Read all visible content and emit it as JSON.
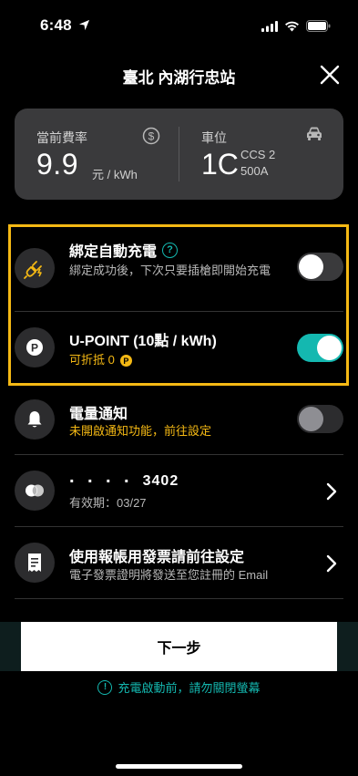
{
  "status": {
    "time": "6:48"
  },
  "header": {
    "title": "臺北 內湖行忠站"
  },
  "info": {
    "rate_label": "當前費率",
    "rate_value": "9.9",
    "rate_unit": "元 / kWh",
    "slot_label": "車位",
    "slot_value": "1C",
    "slot_connector": "CCS 2",
    "slot_current": "500A"
  },
  "auto_charge": {
    "title": "綁定自動充電",
    "help": "?",
    "subtitle": "綁定成功後，下次只要插槍即開始充電",
    "enabled": false
  },
  "upoint": {
    "title": "U-POINT (10點 / kWh)",
    "subtitle": "可折抵 0",
    "coin": "P",
    "enabled": true
  },
  "notify": {
    "title": "電量通知",
    "subtitle": "未開啟通知功能，前往設定",
    "enabled": false
  },
  "card": {
    "masked": "‧ ‧ ‧ ‧",
    "last4": "3402",
    "expiry": "有效期：03/27"
  },
  "invoice": {
    "title": "使用報帳用發票請前往設定",
    "subtitle": "電子發票證明將發送至您註冊的 Email"
  },
  "actions": {
    "next": "下一步"
  },
  "warning": {
    "text": "充電啟動前，請勿關閉螢幕",
    "icon": "!"
  },
  "colors": {
    "accent": "#14b8b0",
    "highlight": "#f5b914",
    "card_bg": "#3a3a3c"
  }
}
